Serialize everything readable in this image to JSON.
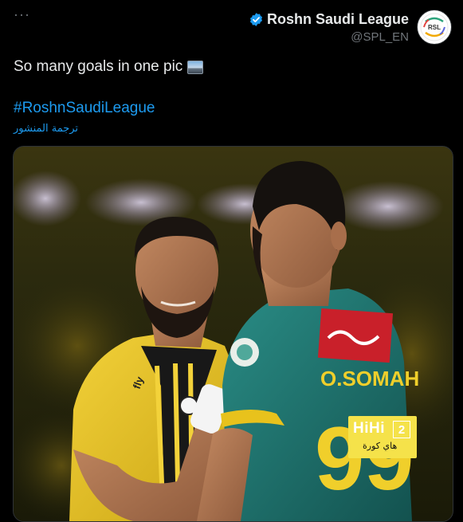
{
  "header": {
    "more_label": "···",
    "display_name": "Roshn Saudi League",
    "handle": "@SPL_EN",
    "avatar_text": "RSL"
  },
  "tweet": {
    "text": "So many goals in one pic",
    "hashtag": "#RoshnSaudiLeague",
    "translate_label": "ترجمة المنشور"
  },
  "photo": {
    "jersey_name": "O.SOMAH",
    "jersey_number": "99",
    "sponsor_text": "fly"
  },
  "watermark": {
    "brand": "HiHi",
    "number": "2",
    "arabic": "هاي كورة"
  },
  "colors": {
    "background": "#000000",
    "text": "#e7e9ea",
    "secondary": "#71767b",
    "link": "#1d9bf0",
    "verified": "#1d9bf0",
    "watermark_bg": "#f5e24a"
  }
}
